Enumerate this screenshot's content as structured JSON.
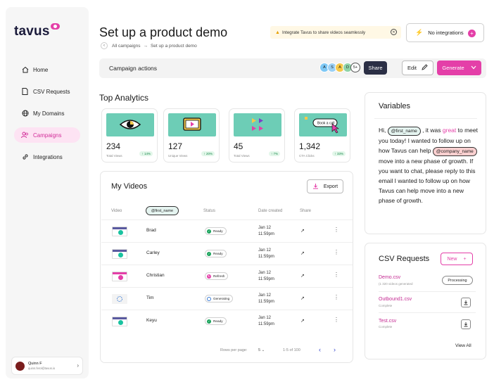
{
  "brand": {
    "logo_text": "tavus",
    "accent": "#e43fa8"
  },
  "sidebar": {
    "items": [
      {
        "label": "Home",
        "icon": "home-icon",
        "active": false
      },
      {
        "label": "CSV Requests",
        "icon": "document-icon",
        "active": false
      },
      {
        "label": "My Domains",
        "icon": "globe-icon",
        "active": false
      },
      {
        "label": "Campaigns",
        "icon": "users-icon",
        "active": true
      },
      {
        "label": "Integrations",
        "icon": "link-icon",
        "active": false
      }
    ],
    "user": {
      "name": "Quinn F",
      "email": "quinn.ferol@tavus.io"
    }
  },
  "header": {
    "title": "Set up a product demo",
    "breadcrumb": {
      "parent": "All campaigns",
      "separator": "→",
      "current": "Set up a product demo"
    },
    "banner_text": "Integrate Tavus to share videos seamlessly",
    "integrations_label": "No integrations"
  },
  "actions": {
    "label": "Campaign actions",
    "avatars": [
      {
        "letter": "A",
        "color": "#7ec8f5"
      },
      {
        "letter": "S",
        "color": "#9ad0f5"
      },
      {
        "letter": "A",
        "color": "#f5c84a"
      },
      {
        "letter": "D",
        "color": "#8fd3a8"
      }
    ],
    "avatars_more": "5+",
    "share_label": "Share",
    "edit_label": "Edit",
    "generate_label": "Generate"
  },
  "analytics": {
    "title": "Top Analytics",
    "stats": [
      {
        "value": "234",
        "label": "Total Views",
        "change": "↑ 14%"
      },
      {
        "value": "127",
        "label": "Unique Views",
        "change": "↑ 20%"
      },
      {
        "value": "45",
        "label": "Total Views",
        "change": "↑ 7%"
      },
      {
        "value": "1,342",
        "label": "CTA Clicks",
        "change": "↑ 33%"
      }
    ],
    "cta_art_text": "Book a call"
  },
  "videos": {
    "title": "My Videos",
    "export_label": "Export",
    "columns": {
      "video": "Video",
      "variable": "@first_name",
      "status": "Status",
      "date": "Date created",
      "share": "Share"
    },
    "rows": [
      {
        "name": "Brad",
        "status": "Ready",
        "status_color": "#19a35b",
        "date": "Jan 12",
        "time": "11:59pm",
        "thumb": "video"
      },
      {
        "name": "Carley",
        "status": "Ready",
        "status_color": "#19a35b",
        "date": "Jan 12",
        "time": "11:59pm",
        "thumb": "video"
      },
      {
        "name": "Christian",
        "status": "Refresh",
        "status_color": "#e43fa8",
        "date": "Jan 12",
        "time": "11:59pm",
        "thumb": "video-pink"
      },
      {
        "name": "Tim",
        "status": "Generating",
        "status_color": "#3a7bd5",
        "date": "Jan 12",
        "time": "11:59pm",
        "thumb": "spinner"
      },
      {
        "name": "Keyu",
        "status": "Ready",
        "status_color": "#19a35b",
        "date": "Jan 12",
        "time": "11:59pm",
        "thumb": "video"
      }
    ],
    "pagination": {
      "rows_label": "Rows per page:",
      "rows_value": "5",
      "range": "1-5 of 100"
    }
  },
  "variables": {
    "title": "Variables",
    "segments": [
      {
        "t": "text",
        "v": "Hi, "
      },
      {
        "t": "chip-green",
        "v": "@first_name"
      },
      {
        "t": "text",
        "v": " , it was "
      },
      {
        "t": "hl",
        "v": "great"
      },
      {
        "t": "text",
        "v": " to meet you today! I wanted to follow up on how Tavus can help "
      },
      {
        "t": "chip-red",
        "v": "@company_name"
      },
      {
        "t": "text",
        "v": " move into a new phase of growth. If you want to chat, please reply to this email I wanted to follow up on how Tavus can help move into a new phase of growth."
      }
    ]
  },
  "csv": {
    "title": "CSV Requests",
    "new_label": "New",
    "requests": [
      {
        "name": "Demo.csv",
        "sub": "(1 320 videos generated",
        "action": "Processing"
      },
      {
        "name": "Outbound1.csv",
        "sub": "Complete",
        "action": "download"
      },
      {
        "name": "Test.csv",
        "sub": "Complete",
        "action": "download"
      }
    ],
    "view_all": "View All"
  }
}
